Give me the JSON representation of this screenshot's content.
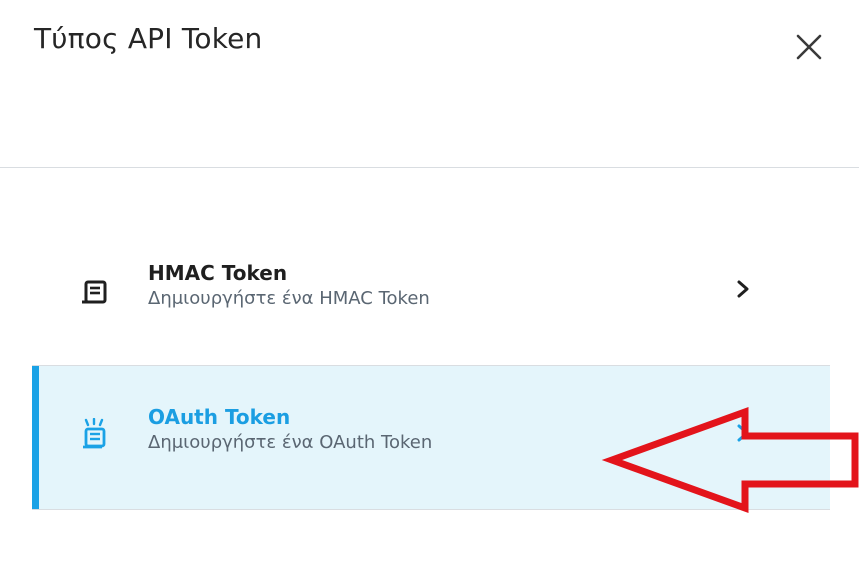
{
  "dialog": {
    "title": "Τύπος API Token",
    "close_icon": "close-icon"
  },
  "options": [
    {
      "title": "HMAC Token",
      "description": "Δημιουργήστε ένα HMAC Token",
      "icon": "document-icon",
      "selected": false
    },
    {
      "title": "OAuth Token",
      "description": "Δημιουργήστε ένα OAuth Token",
      "icon": "document-sparkle-icon",
      "selected": true
    }
  ],
  "colors": {
    "accent": "#1aa2e6",
    "selected_background": "#e4f5fb",
    "annotation_arrow": "#e3141b"
  }
}
